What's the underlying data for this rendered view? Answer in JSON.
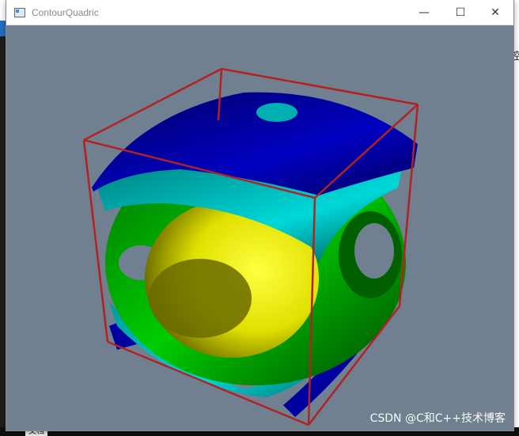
{
  "window": {
    "title": "ContourQuadric",
    "controls": {
      "minimize": "—",
      "maximize": "☐",
      "close": "✕"
    }
  },
  "scene": {
    "background_color": "#708090",
    "outline_color": "#b22222",
    "surface_colors": [
      "#0000aa",
      "#00d0d0",
      "#00cc00",
      "#ffff00"
    ]
  },
  "watermark": "CSDN @C和C++技术博客",
  "desktop": {
    "right_char": "控",
    "doc_label": "文档"
  }
}
